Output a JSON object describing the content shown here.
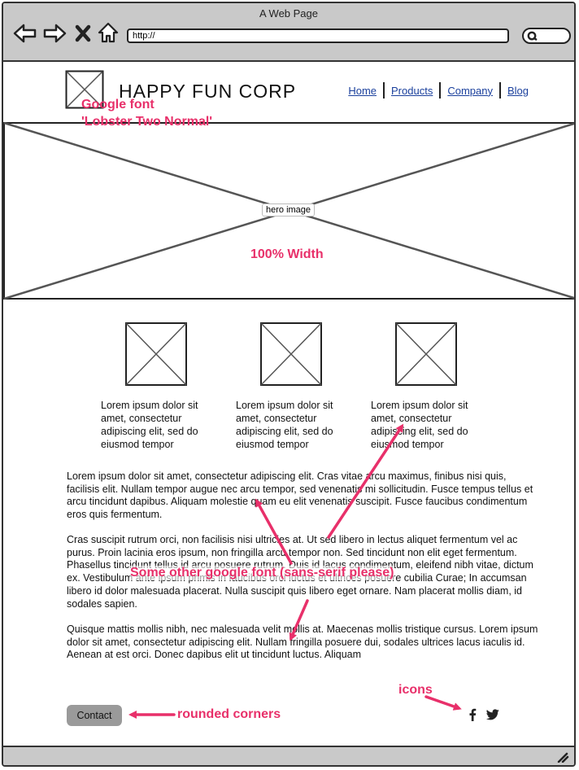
{
  "browser": {
    "title": "A Web Page",
    "url": "http://"
  },
  "header": {
    "company": "HAPPY FUN CORP",
    "nav": [
      "Home",
      "Products",
      "Company",
      "Blog"
    ]
  },
  "hero": {
    "label": "hero image"
  },
  "features": [
    {
      "text": "Lorem ipsum dolor sit amet, consectetur adipiscing elit, sed do eiusmod tempor"
    },
    {
      "text": "Lorem ipsum dolor sit amet, consectetur adipiscing elit, sed do eiusmod tempor"
    },
    {
      "text": "Lorem ipsum dolor sit amet, consectetur adipiscing elit, sed do eiusmod tempor"
    }
  ],
  "paragraphs": [
    "Lorem ipsum dolor sit amet, consectetur adipiscing elit. Cras vitae arcu maximus, finibus nisi quis, facilisis elit. Nullam tempor augue nec arcu tempor, sed venenatis mi sollicitudin. Fusce tempus tellus et arcu tincidunt dapibus. Aliquam molestie quam eu elit venenatis suscipit. Fusce faucibus condimentum eros quis fermentum.",
    "Cras suscipit rutrum orci, non facilisis nisi ultricies at. Ut sed libero in lectus aliquet fermentum vel ac purus. Proin lacinia eros ipsum, non fringilla arcu tempor non. Sed tincidunt non elit eget fermentum. Phasellus tincidunt tellus id arcu posuere rutrum. Duis id lacus condimentum, eleifend nibh vitae, dictum ex. Vestibulum ante ipsum primis in faucibus orci luctus et ultrices posuere cubilia Curae; In accumsan libero id dolor malesuada placerat. Nulla suscipit quis libero eget ornare. Nam placerat mollis diam, id sodales sapien.",
    "Quisque mattis mollis nibh, nec malesuada velit mollis at. Maecenas mollis tristique cursus. Lorem ipsum dolor sit amet, consectetur adipiscing elit. Nullam fringilla posuere dui, sodales ultrices lacus iaculis id. Aenean at est orci. Donec dapibus elit ut tincidunt luctus. Aliquam"
  ],
  "footer": {
    "contact_label": "Contact"
  },
  "annotations": {
    "font_note_line1": "Google font",
    "font_note_line2": "'Lobster Two Normal'",
    "width_note": "100% Width",
    "sans_note": "Some other google font (sans-serif please)",
    "rounded_note": "rounded corners",
    "icons_note": "icons"
  },
  "icons": [
    "back-icon",
    "forward-icon",
    "stop-icon",
    "home-icon",
    "search-icon",
    "facebook-icon",
    "twitter-icon",
    "resize-grip-icon"
  ],
  "colors": {
    "annotation": "#e8306a",
    "link": "#1a3f9c",
    "chrome": "#c9c9c9",
    "button": "#9a9a9a"
  }
}
